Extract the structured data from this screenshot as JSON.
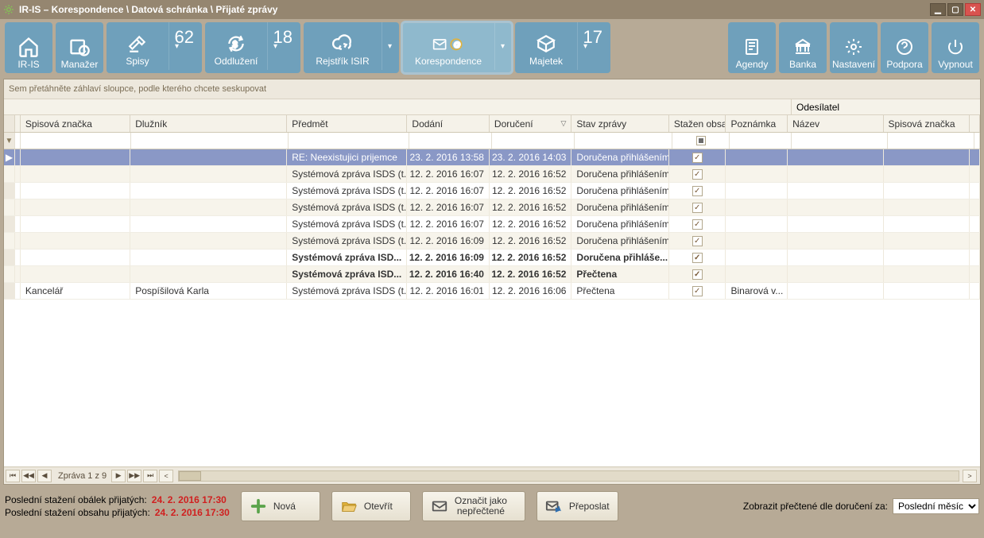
{
  "title": "IR-IS – Korespondence \\ Datová schránka \\ Přijaté zprávy",
  "ribbon": {
    "iris": "IR-IS",
    "manazer": "Manažer",
    "spisy": {
      "label": "Spisy",
      "count": "62"
    },
    "oddluzeni": {
      "label": "Oddlužení",
      "count": "18"
    },
    "rejstrik": "Rejstřík ISIR",
    "korespondence": "Korespondence",
    "majetek": {
      "label": "Majetek",
      "count": "17"
    },
    "agendy": "Agendy",
    "banka": "Banka",
    "nastaveni": "Nastavení",
    "podpora": "Podpora",
    "vypnout": "Vypnout"
  },
  "groupBar": "Sem přetáhněte záhlaví sloupce, podle kterého chcete seskupovat",
  "columns": {
    "spisova": "Spisová značka",
    "dluznik": "Dlužník",
    "predmet": "Předmět",
    "dodani": "Dodání",
    "doruceni": "Doručení",
    "stav": "Stav zprávy",
    "stazen": "Stažen obsah",
    "poznamka": "Poznámka",
    "odesilatel": "Odesílatel",
    "nazev": "Název",
    "spis2": "Spisová značka"
  },
  "rows": [
    {
      "selected": true,
      "bold": false,
      "spisova": "",
      "dluznik": "",
      "predmet": "RE: Neexistujici prijemce",
      "dodani": "23. 2. 2016 13:58",
      "doruceni": "23. 2. 2016 14:03",
      "stav": "Doručena přihlášením",
      "stazen": true,
      "pozn": "",
      "nazev": "",
      "spis2": ""
    },
    {
      "selected": false,
      "bold": false,
      "spisova": "",
      "dluznik": "",
      "predmet": "Systémová zpráva ISDS (t...",
      "dodani": "12. 2. 2016 16:07",
      "doruceni": "12. 2. 2016 16:52",
      "stav": "Doručena přihlášením",
      "stazen": true,
      "pozn": "",
      "nazev": "",
      "spis2": ""
    },
    {
      "selected": false,
      "bold": false,
      "spisova": "",
      "dluznik": "",
      "predmet": "Systémová zpráva ISDS (t...",
      "dodani": "12. 2. 2016 16:07",
      "doruceni": "12. 2. 2016 16:52",
      "stav": "Doručena přihlášením",
      "stazen": true,
      "pozn": "",
      "nazev": "",
      "spis2": ""
    },
    {
      "selected": false,
      "bold": false,
      "spisova": "",
      "dluznik": "",
      "predmet": "Systémová zpráva ISDS (t...",
      "dodani": "12. 2. 2016 16:07",
      "doruceni": "12. 2. 2016 16:52",
      "stav": "Doručena přihlášením",
      "stazen": true,
      "pozn": "",
      "nazev": "",
      "spis2": ""
    },
    {
      "selected": false,
      "bold": false,
      "spisova": "",
      "dluznik": "",
      "predmet": "Systémová zpráva ISDS (t...",
      "dodani": "12. 2. 2016 16:07",
      "doruceni": "12. 2. 2016 16:52",
      "stav": "Doručena přihlášením",
      "stazen": true,
      "pozn": "",
      "nazev": "",
      "spis2": ""
    },
    {
      "selected": false,
      "bold": false,
      "spisova": "",
      "dluznik": "",
      "predmet": "Systémová zpráva ISDS (t...",
      "dodani": "12. 2. 2016 16:09",
      "doruceni": "12. 2. 2016 16:52",
      "stav": "Doručena přihlášením",
      "stazen": true,
      "pozn": "",
      "nazev": "",
      "spis2": ""
    },
    {
      "selected": false,
      "bold": true,
      "spisova": "",
      "dluznik": "",
      "predmet": "Systémová zpráva ISD...",
      "dodani": "12. 2. 2016 16:09",
      "doruceni": "12. 2. 2016 16:52",
      "stav": "Doručena přihláše...",
      "stazen": true,
      "pozn": "",
      "nazev": "",
      "spis2": ""
    },
    {
      "selected": false,
      "bold": true,
      "spisova": "",
      "dluznik": "",
      "predmet": "Systémová zpráva ISD...",
      "dodani": "12. 2. 2016 16:40",
      "doruceni": "12. 2. 2016 16:52",
      "stav": "Přečtena",
      "stazen": true,
      "pozn": "",
      "nazev": "",
      "spis2": ""
    },
    {
      "selected": false,
      "bold": false,
      "spisova": "Kancelář",
      "dluznik": "Pospíšilová Karla",
      "predmet": "Systémová zpráva ISDS (t...",
      "dodani": "12. 2. 2016 16:01",
      "doruceni": "12. 2. 2016 16:06",
      "stav": "Přečtena",
      "stazen": true,
      "pozn": "Binarová v...",
      "nazev": "",
      "spis2": ""
    }
  ],
  "pager": {
    "text": "Zpráva 1 z 9"
  },
  "status": {
    "line1_label": "Poslední stažení obálek přijatých:",
    "line1_value": "24. 2. 2016 17:30",
    "line2_label": "Poslední stažení obsahu přijatých:",
    "line2_value": "24. 2. 2016 17:30"
  },
  "buttons": {
    "nova": "Nová",
    "otevrit": "Otevřít",
    "oznacit": "Označit jako\nnepřečtené",
    "preposlat": "Přeposlat"
  },
  "filter": {
    "label": "Zobrazit přečtené dle doručení za:",
    "value": "Poslední měsíc"
  }
}
